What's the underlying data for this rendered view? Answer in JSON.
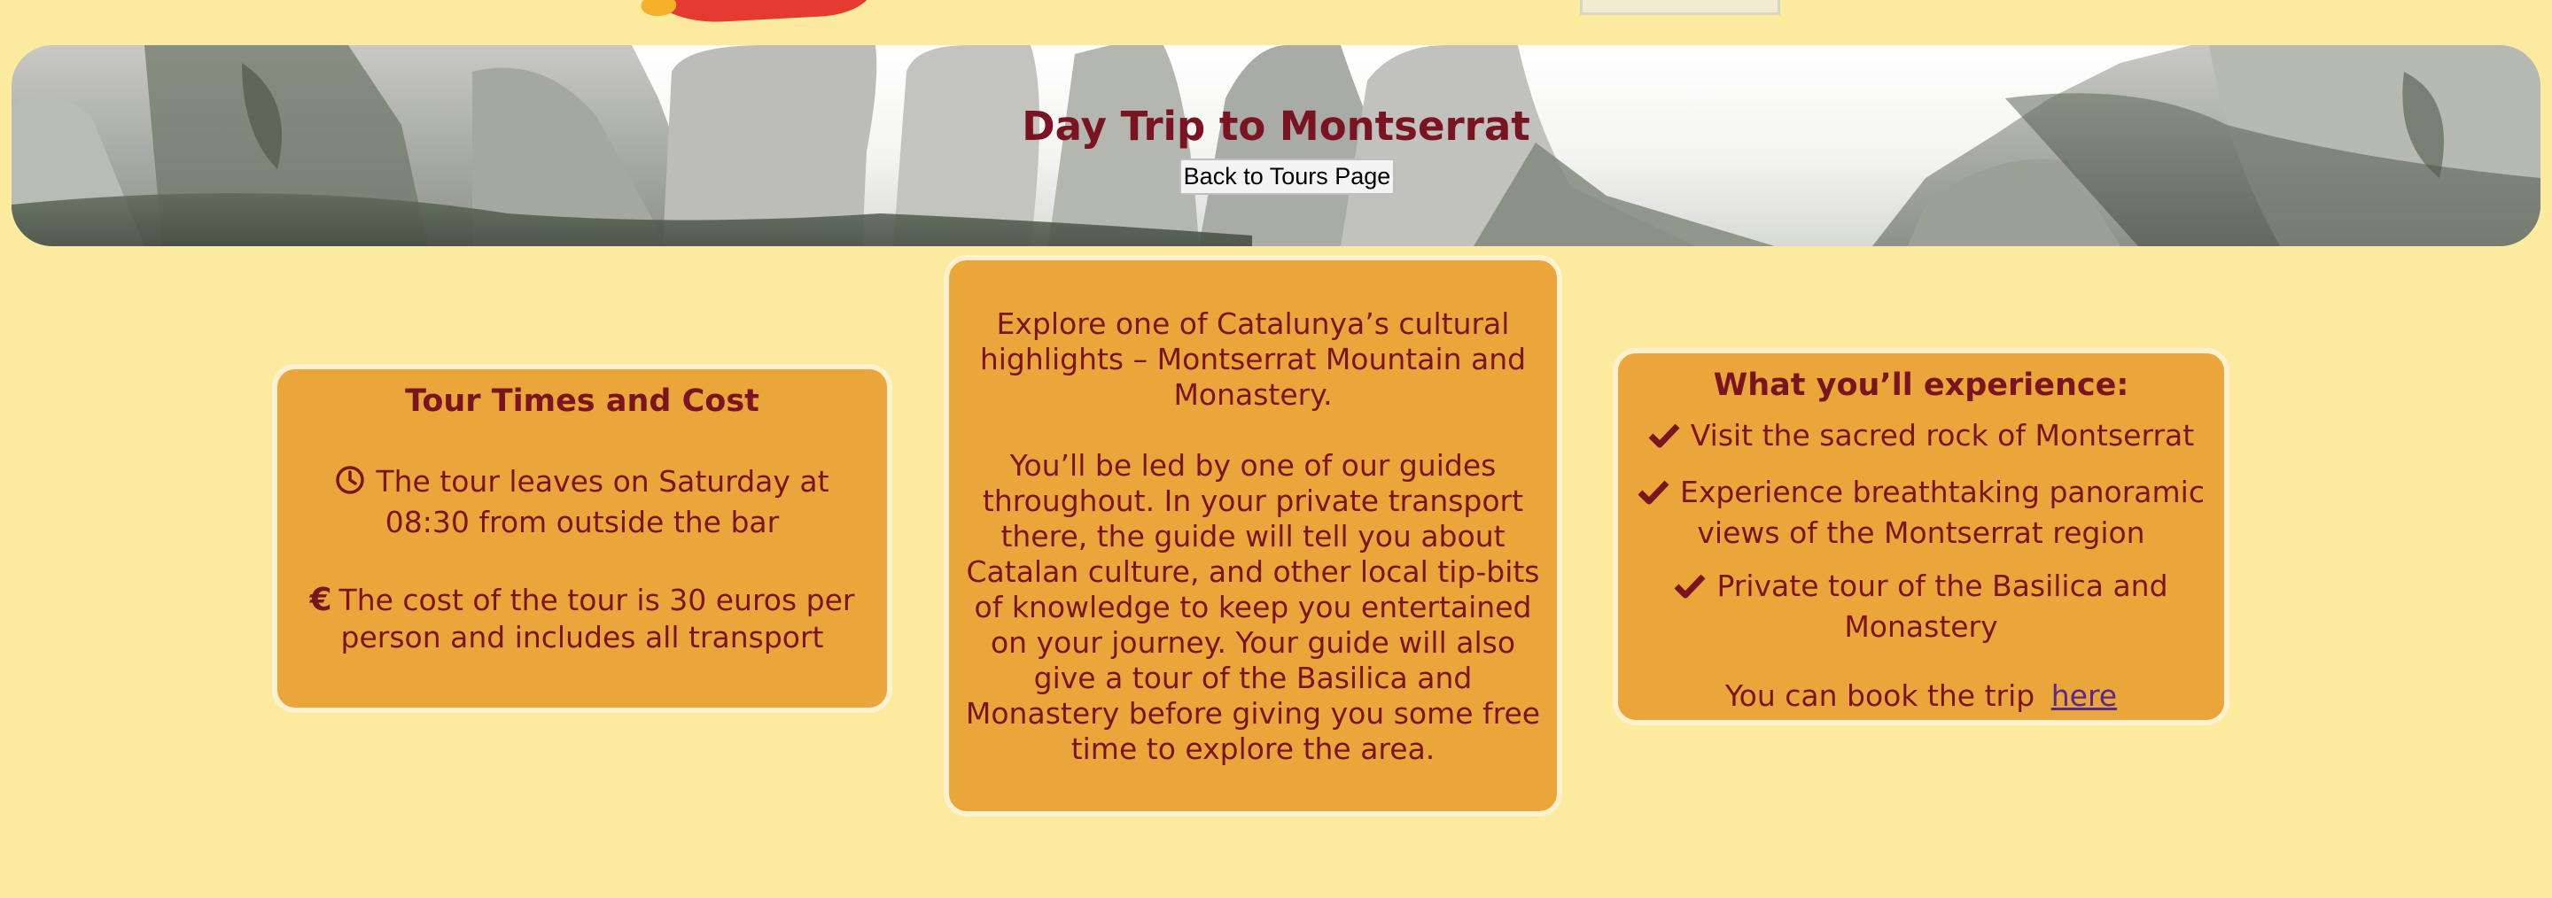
{
  "hero": {
    "title": "Day Trip to Montserrat",
    "back_button": "Back to Tours Page"
  },
  "tour_card": {
    "heading": "Tour Times and Cost",
    "items": [
      {
        "icon": "clock-icon",
        "text": "The tour leaves on Saturday at 08:30 from outside the bar"
      },
      {
        "icon": "euro-icon",
        "text": "The cost of the tour is 30 euros per person and includes all transport"
      }
    ]
  },
  "description_card": {
    "paragraph1": "Explore one of Catalunya’s cultural highlights – Montserrat Mountain and Monastery.",
    "paragraph2": "You’ll be led by one of our guides throughout. In your private transport there, the guide will tell you about Catalan culture, and other local tip-bits of knowledge to keep you entertained on your journey. Your guide will also give a tour of the Basilica and Monastery before giving you some free time to explore the area."
  },
  "experience_card": {
    "heading": "What you’ll experience:",
    "items": [
      "Visit the sacred rock of Montserrat",
      "Experience breathtaking panoramic views of the Montserrat region",
      "Private tour of the Basilica and Monastery"
    ],
    "book_text": "You can book the trip",
    "book_link": "here"
  },
  "colors": {
    "page_background": "#fcea9f",
    "card_background": "#eba63b",
    "text": "#7a1420",
    "link": "#5a2a8a"
  }
}
